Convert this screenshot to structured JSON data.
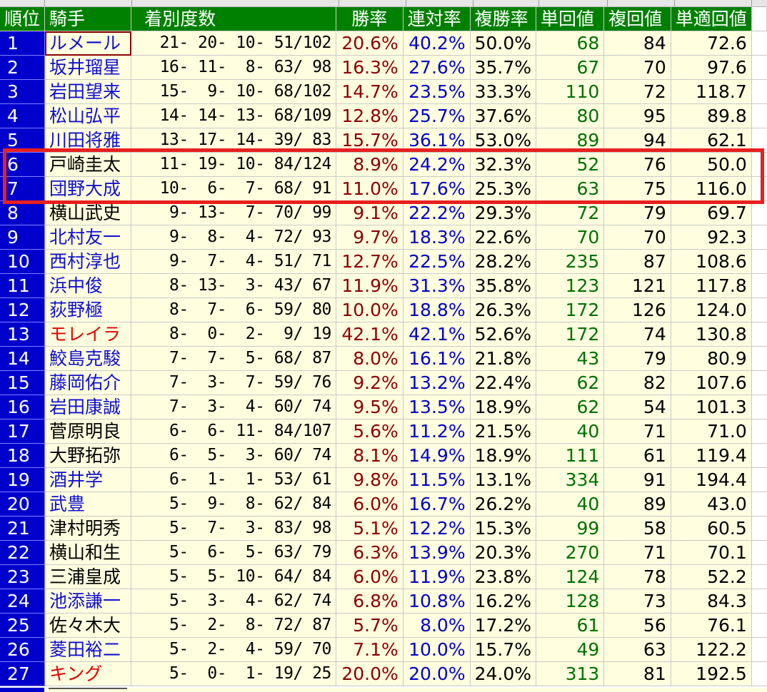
{
  "headers": {
    "rank": "順位",
    "jockey": "騎手",
    "record": "着別度数",
    "win_rate": "勝率",
    "quinella_rate": "連対率",
    "show_rate": "複勝率",
    "win_return": "単回値",
    "show_return": "複回値",
    "adj_win_return": "単適回値"
  },
  "rows": [
    {
      "rank": "1",
      "jockey": "ルメール",
      "color": "blue",
      "record": "21- 20- 10- 51/102",
      "win": "20.6%",
      "ren": "40.2%",
      "fuku": "50.0%",
      "tan": "68",
      "fkv": "84",
      "tek": "72.6"
    },
    {
      "rank": "2",
      "jockey": "坂井瑠星",
      "color": "blue",
      "record": "16- 11-  8- 63/ 98",
      "win": "16.3%",
      "ren": "27.6%",
      "fuku": "35.7%",
      "tan": "67",
      "fkv": "70",
      "tek": "97.6"
    },
    {
      "rank": "3",
      "jockey": "岩田望来",
      "color": "blue",
      "record": "15-  9- 10- 68/102",
      "win": "14.7%",
      "ren": "23.5%",
      "fuku": "33.3%",
      "tan": "110",
      "fkv": "72",
      "tek": "118.7"
    },
    {
      "rank": "4",
      "jockey": "松山弘平",
      "color": "blue",
      "record": "14- 14- 13- 68/109",
      "win": "12.8%",
      "ren": "25.7%",
      "fuku": "37.6%",
      "tan": "80",
      "fkv": "95",
      "tek": "89.8"
    },
    {
      "rank": "5",
      "jockey": "川田将雅",
      "color": "blue",
      "record": "13- 17- 14- 39/ 83",
      "win": "15.7%",
      "ren": "36.1%",
      "fuku": "53.0%",
      "tan": "89",
      "fkv": "94",
      "tek": "62.1"
    },
    {
      "rank": "6",
      "jockey": "戸崎圭太",
      "color": "black",
      "record": "11- 19- 10- 84/124",
      "win": "8.9%",
      "ren": "24.2%",
      "fuku": "32.3%",
      "tan": "52",
      "fkv": "76",
      "tek": "50.0"
    },
    {
      "rank": "7",
      "jockey": "団野大成",
      "color": "blue",
      "record": "10-  6-  7- 68/ 91",
      "win": "11.0%",
      "ren": "17.6%",
      "fuku": "25.3%",
      "tan": "63",
      "fkv": "75",
      "tek": "116.0"
    },
    {
      "rank": "8",
      "jockey": "横山武史",
      "color": "black",
      "record": " 9- 13-  7- 70/ 99",
      "win": "9.1%",
      "ren": "22.2%",
      "fuku": "29.3%",
      "tan": "72",
      "fkv": "79",
      "tek": "69.7"
    },
    {
      "rank": "9",
      "jockey": "北村友一",
      "color": "blue",
      "record": " 9-  8-  4- 72/ 93",
      "win": "9.7%",
      "ren": "18.3%",
      "fuku": "22.6%",
      "tan": "70",
      "fkv": "70",
      "tek": "92.3"
    },
    {
      "rank": "10",
      "jockey": "西村淳也",
      "color": "blue",
      "record": " 9-  7-  4- 51/ 71",
      "win": "12.7%",
      "ren": "22.5%",
      "fuku": "28.2%",
      "tan": "235",
      "fkv": "87",
      "tek": "108.6"
    },
    {
      "rank": "11",
      "jockey": "浜中俊",
      "color": "blue",
      "record": " 8- 13-  3- 43/ 67",
      "win": "11.9%",
      "ren": "31.3%",
      "fuku": "35.8%",
      "tan": "123",
      "fkv": "121",
      "tek": "117.8"
    },
    {
      "rank": "12",
      "jockey": "荻野極",
      "color": "blue",
      "record": " 8-  7-  6- 59/ 80",
      "win": "10.0%",
      "ren": "18.8%",
      "fuku": "26.3%",
      "tan": "172",
      "fkv": "126",
      "tek": "124.0"
    },
    {
      "rank": "13",
      "jockey": "モレイラ",
      "color": "red",
      "record": " 8-  0-  2-  9/ 19",
      "win": "42.1%",
      "ren": "42.1%",
      "fuku": "52.6%",
      "tan": "172",
      "fkv": "74",
      "tek": "130.8"
    },
    {
      "rank": "14",
      "jockey": "鮫島克駿",
      "color": "blue",
      "record": " 7-  7-  5- 68/ 87",
      "win": "8.0%",
      "ren": "16.1%",
      "fuku": "21.8%",
      "tan": "43",
      "fkv": "79",
      "tek": "80.9"
    },
    {
      "rank": "15",
      "jockey": "藤岡佑介",
      "color": "blue",
      "record": " 7-  3-  7- 59/ 76",
      "win": "9.2%",
      "ren": "13.2%",
      "fuku": "22.4%",
      "tan": "62",
      "fkv": "82",
      "tek": "107.6"
    },
    {
      "rank": "16",
      "jockey": "岩田康誠",
      "color": "blue",
      "record": " 7-  3-  4- 60/ 74",
      "win": "9.5%",
      "ren": "13.5%",
      "fuku": "18.9%",
      "tan": "62",
      "fkv": "54",
      "tek": "101.3"
    },
    {
      "rank": "17",
      "jockey": "菅原明良",
      "color": "black",
      "record": " 6-  6- 11- 84/107",
      "win": "5.6%",
      "ren": "11.2%",
      "fuku": "21.5%",
      "tan": "40",
      "fkv": "71",
      "tek": "71.0"
    },
    {
      "rank": "18",
      "jockey": "大野拓弥",
      "color": "black",
      "record": " 6-  5-  3- 60/ 74",
      "win": "8.1%",
      "ren": "14.9%",
      "fuku": "18.9%",
      "tan": "111",
      "fkv": "61",
      "tek": "119.4"
    },
    {
      "rank": "19",
      "jockey": "酒井学",
      "color": "blue",
      "record": " 6-  1-  1- 53/ 61",
      "win": "9.8%",
      "ren": "11.5%",
      "fuku": "13.1%",
      "tan": "334",
      "fkv": "91",
      "tek": "194.4"
    },
    {
      "rank": "20",
      "jockey": "武豊",
      "color": "blue",
      "record": " 5-  9-  8- 62/ 84",
      "win": "6.0%",
      "ren": "16.7%",
      "fuku": "26.2%",
      "tan": "40",
      "fkv": "89",
      "tek": "43.0"
    },
    {
      "rank": "21",
      "jockey": "津村明秀",
      "color": "black",
      "record": " 5-  7-  3- 83/ 98",
      "win": "5.1%",
      "ren": "12.2%",
      "fuku": "15.3%",
      "tan": "99",
      "fkv": "58",
      "tek": "60.5"
    },
    {
      "rank": "22",
      "jockey": "横山和生",
      "color": "black",
      "record": " 5-  6-  5- 63/ 79",
      "win": "6.3%",
      "ren": "13.9%",
      "fuku": "20.3%",
      "tan": "270",
      "fkv": "71",
      "tek": "70.1"
    },
    {
      "rank": "23",
      "jockey": "三浦皇成",
      "color": "black",
      "record": " 5-  5- 10- 64/ 84",
      "win": "6.0%",
      "ren": "11.9%",
      "fuku": "23.8%",
      "tan": "124",
      "fkv": "78",
      "tek": "52.2"
    },
    {
      "rank": "24",
      "jockey": "池添謙一",
      "color": "blue",
      "record": " 5-  3-  4- 62/ 74",
      "win": "6.8%",
      "ren": "10.8%",
      "fuku": "16.2%",
      "tan": "128",
      "fkv": "73",
      "tek": "84.3"
    },
    {
      "rank": "25",
      "jockey": "佐々木大",
      "color": "black",
      "record": " 5-  2-  8- 72/ 87",
      "win": "5.7%",
      "ren": "8.0%",
      "fuku": "17.2%",
      "tan": "61",
      "fkv": "56",
      "tek": "76.1"
    },
    {
      "rank": "26",
      "jockey": "菱田裕二",
      "color": "blue",
      "record": " 5-  2-  4- 59/ 70",
      "win": "7.1%",
      "ren": "10.0%",
      "fuku": "15.7%",
      "tan": "49",
      "fkv": "63",
      "tek": "122.2"
    },
    {
      "rank": "27",
      "jockey": "キング",
      "color": "red",
      "record": " 5-  0-  1- 19/ 25",
      "win": "20.0%",
      "ren": "20.0%",
      "fuku": "24.0%",
      "tan": "313",
      "fkv": "81",
      "tek": "192.5"
    }
  ],
  "colors": {
    "header_bg": "#008000",
    "rank_bg": "#0000cc",
    "cell_bg": "#ffffe0",
    "win_rate": "#8b0000",
    "quinella_rate": "#0000cc",
    "win_return": "#007000",
    "highlight_box": "#e82020"
  },
  "selected_cell": "ルメール",
  "highlighted_rows": [
    "6",
    "7"
  ]
}
